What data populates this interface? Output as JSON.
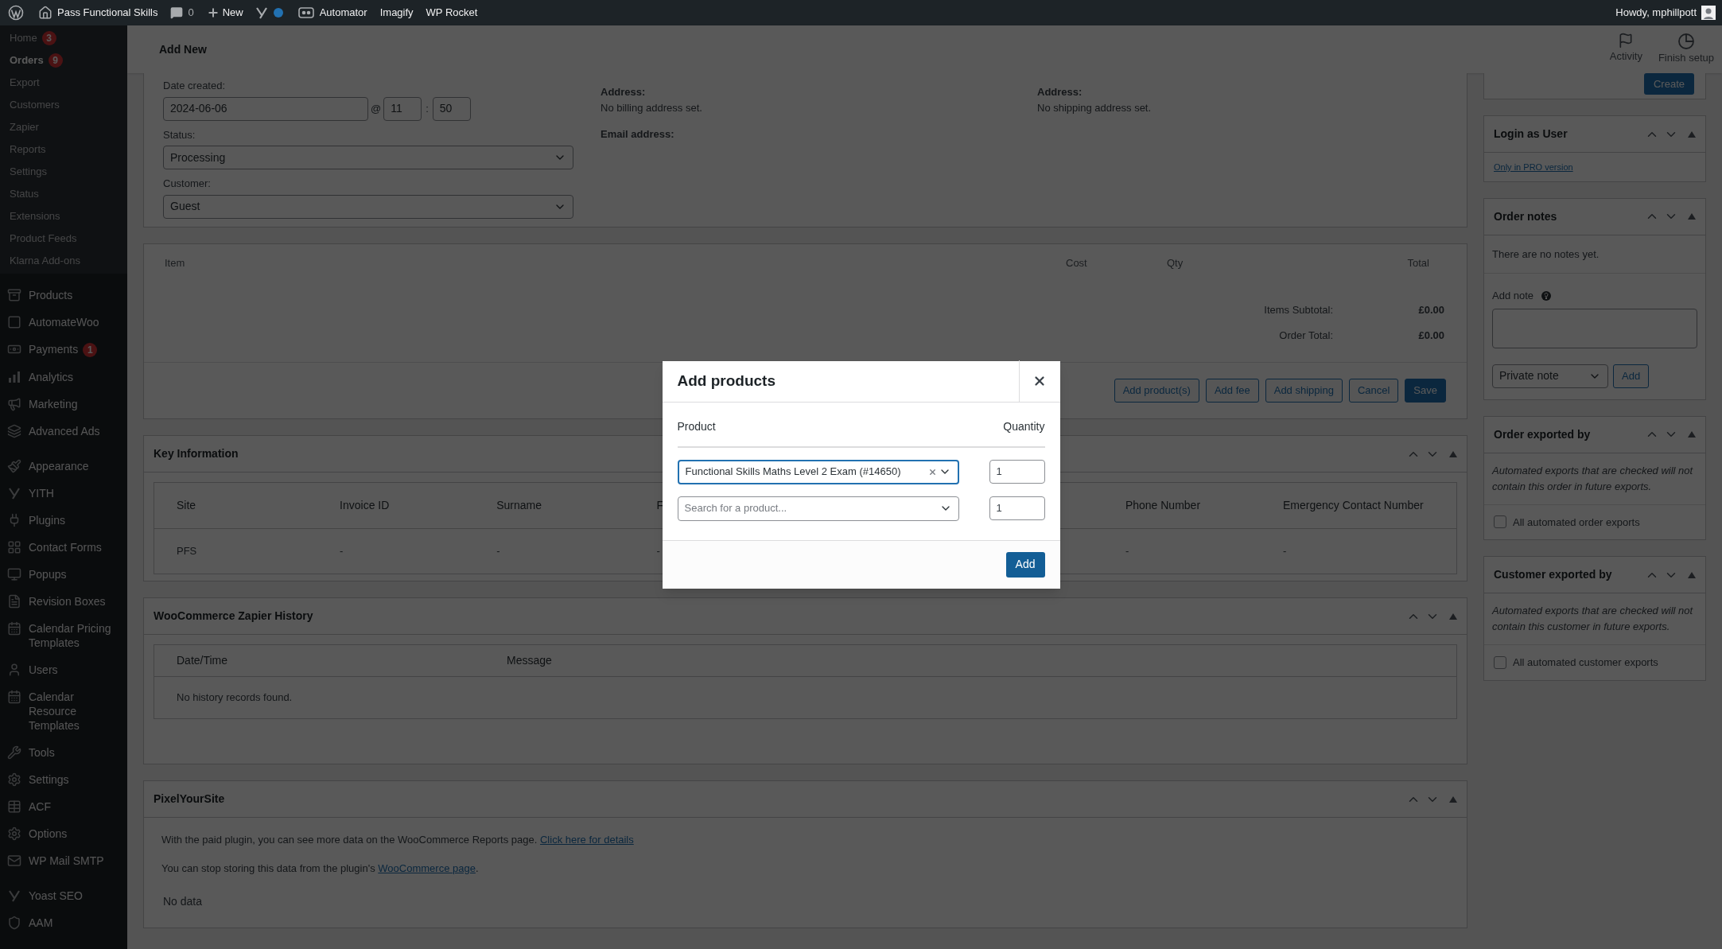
{
  "admin_bar": {
    "site": "Pass Functional Skills",
    "comments": "0",
    "new": "New",
    "plugins": [
      "Automator",
      "Imagify",
      "WP Rocket"
    ],
    "greeting": "Howdy, mphillpott"
  },
  "sidebar": {
    "submenu": [
      {
        "label": "Home",
        "badge": "3",
        "selected": false
      },
      {
        "label": "Orders",
        "badge": "9",
        "selected": true
      },
      {
        "label": "Export",
        "selected": false
      },
      {
        "label": "Customers",
        "selected": false
      },
      {
        "label": "Zapier",
        "selected": false
      },
      {
        "label": "Reports",
        "selected": false
      },
      {
        "label": "Settings",
        "selected": false
      },
      {
        "label": "Status",
        "selected": false
      },
      {
        "label": "Extensions",
        "selected": false
      },
      {
        "label": "Product Feeds",
        "selected": false
      },
      {
        "label": "Klarna Add-ons",
        "selected": false
      }
    ],
    "menu_groups": [
      [
        {
          "label": "Products"
        },
        {
          "label": "AutomateWoo"
        },
        {
          "label": "Payments",
          "badge": "1"
        },
        {
          "label": "Analytics"
        },
        {
          "label": "Marketing"
        },
        {
          "label": "Advanced Ads"
        }
      ],
      [
        {
          "label": "Appearance"
        },
        {
          "label": "YITH"
        },
        {
          "label": "Plugins"
        },
        {
          "label": "Contact Forms"
        },
        {
          "label": "Popups"
        },
        {
          "label": "Revision Boxes"
        },
        {
          "label": "Calendar Pricing Templates"
        },
        {
          "label": "Users"
        },
        {
          "label": "Calendar Resource Templates"
        },
        {
          "label": "Tools"
        },
        {
          "label": "Settings"
        },
        {
          "label": "ACF"
        },
        {
          "label": "Options"
        },
        {
          "label": "WP Mail SMTP"
        }
      ],
      [
        {
          "label": "Yoast SEO"
        },
        {
          "label": "AAM"
        }
      ]
    ]
  },
  "header": {
    "title": "Add New",
    "actions": [
      "Activity",
      "Finish setup"
    ]
  },
  "order_details": {
    "date_label": "Date created:",
    "date": "2024-06-06",
    "at": "@",
    "hour": "11",
    "colon": ":",
    "minute": "50",
    "status_label": "Status:",
    "status": "Processing",
    "customer_label": "Customer:",
    "customer": "Guest",
    "billing": {
      "label": "Address:",
      "value": "No billing address set.",
      "email_label": "Email address:"
    },
    "shipping": {
      "label": "Address:",
      "value": "No shipping address set."
    }
  },
  "items": {
    "columns": [
      "Item",
      "Cost",
      "Qty",
      "Total"
    ],
    "totals": [
      {
        "label": "Items Subtotal:",
        "value": "£0.00"
      },
      {
        "label": "Order Total:",
        "value": "£0.00"
      }
    ],
    "buttons": [
      {
        "label": "Add product(s)",
        "primary": false
      },
      {
        "label": "Add fee",
        "primary": false
      },
      {
        "label": "Add shipping",
        "primary": false
      },
      {
        "label": "Cancel",
        "primary": false
      },
      {
        "label": "Save",
        "primary": true
      }
    ]
  },
  "key_information": {
    "title": "Key Information",
    "columns": [
      "Site",
      "Invoice ID",
      "Surname",
      "F",
      "Phone Number",
      "Emergency Contact Number"
    ],
    "rows": [
      [
        "PFS",
        "-",
        "-",
        "-",
        "-",
        "-"
      ]
    ]
  },
  "zapier_history": {
    "title": "WooCommerce Zapier History",
    "columns": [
      "Date/Time",
      "Message"
    ],
    "empty": "No history records found."
  },
  "pixelyoursite": {
    "title": "PixelYourSite",
    "lines": [
      {
        "text": "With the paid plugin, you can see more data on the WooCommerce Reports page.",
        "link": "Click here for details"
      },
      {
        "text": "You can stop storing this data from the plugin's",
        "link": "WooCommerce page",
        "after": "."
      }
    ],
    "no_data": "No data"
  },
  "right_column": {
    "create": "Create",
    "login_as_user": {
      "title": "Login as User",
      "link": "Only in PRO version"
    },
    "order_notes": {
      "title": "Order notes",
      "empty": "There are no notes yet.",
      "add_note_label": "Add note",
      "note_type": "Private note",
      "add": "Add"
    },
    "exports": [
      {
        "title": "Order exported by",
        "description": "Automated exports that are checked will not contain this order in future exports.",
        "checkbox": "All automated order exports",
        "checked": false
      },
      {
        "title": "Customer exported by",
        "description": "Automated exports that are checked will not contain this customer in future exports.",
        "checkbox": "All automated customer exports",
        "checked": false
      }
    ]
  },
  "modal": {
    "title": "Add products",
    "columns": [
      "Product",
      "Quantity"
    ],
    "rows": [
      {
        "product": "Functional Skills Maths Level 2 Exam (#14650)",
        "quantity": "1",
        "focused": true
      },
      {
        "placeholder": "Search for a product...",
        "quantity": "1",
        "focused": false
      }
    ],
    "add": "Add"
  }
}
